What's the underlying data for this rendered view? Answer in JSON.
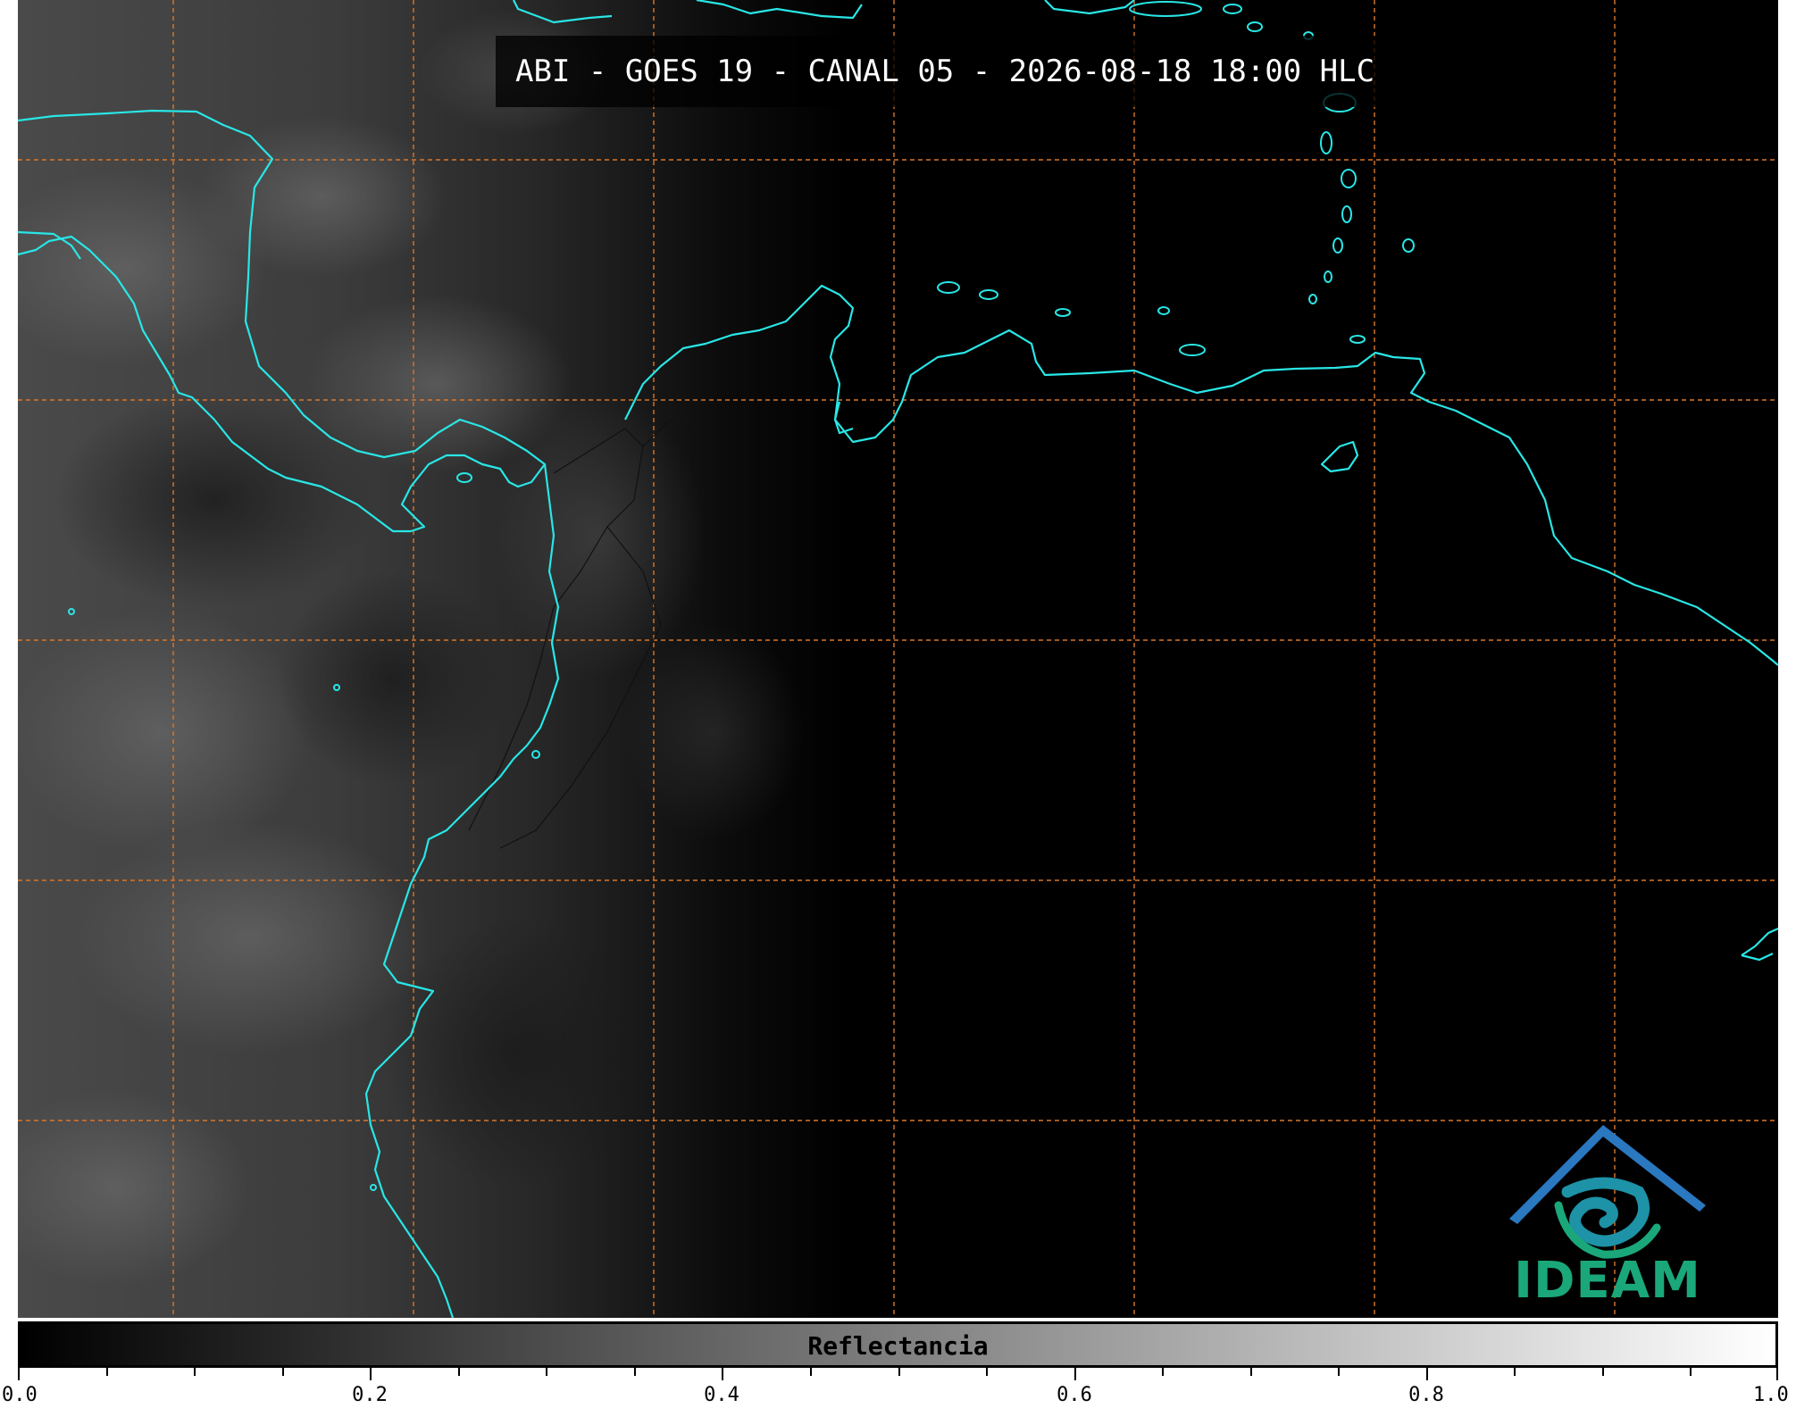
{
  "title": "ABI - GOES 19 - CANAL 05 - 2026-08-18 18:00 HLC",
  "colors": {
    "coastline": "#29e6e6",
    "grid": "#d9772a",
    "background": "#000000",
    "logo_blue": "#2a78c0",
    "logo_green": "#1aa87a"
  },
  "logo": {
    "text": "IDEAM"
  },
  "colorbar": {
    "label": "Reflectancia",
    "min": 0.0,
    "max": 1.0,
    "colormap": "grayscale",
    "tick_labels": [
      "0.0",
      "0.2",
      "0.4",
      "0.6",
      "0.8",
      "1.0"
    ]
  }
}
